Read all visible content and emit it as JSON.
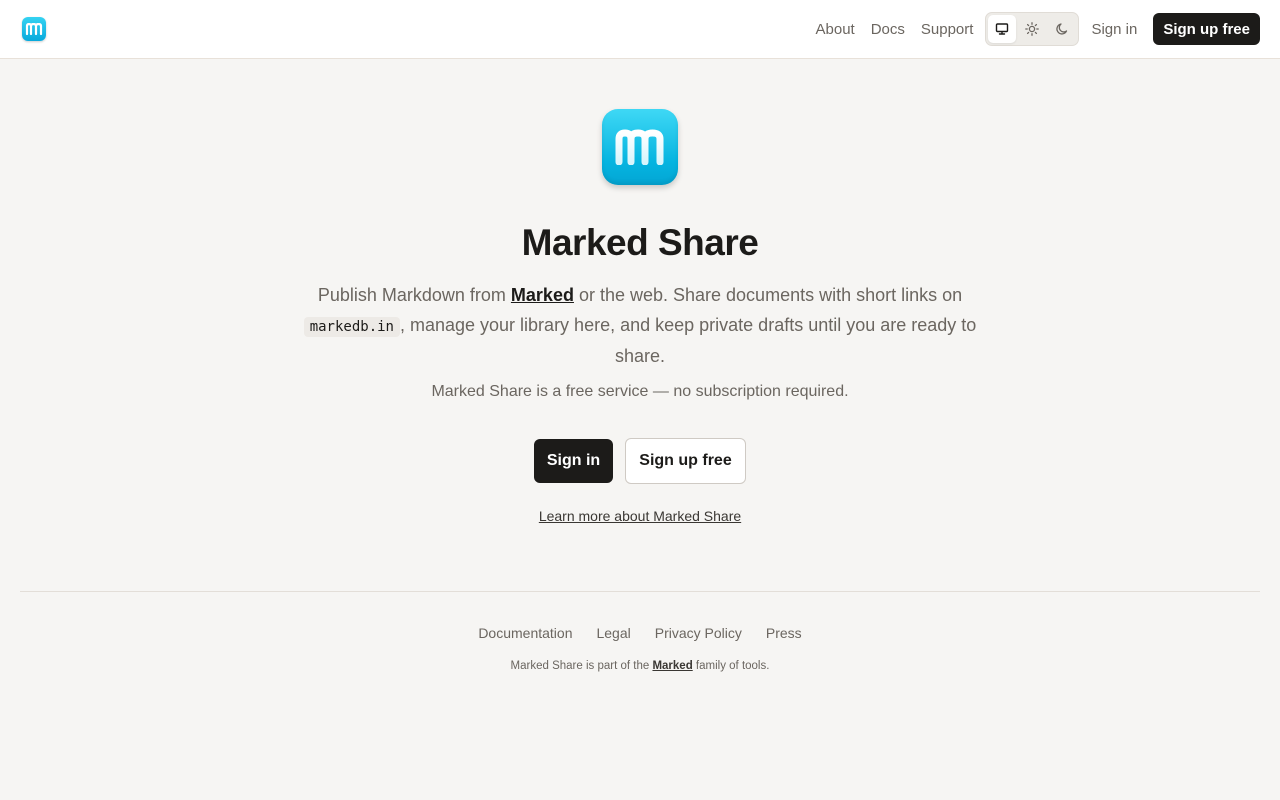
{
  "header": {
    "logo_icon": "marked-logo-icon",
    "nav": {
      "about": "About",
      "docs": "Docs",
      "support": "Support"
    },
    "theme_toggle": {
      "options": [
        {
          "icon": "monitor-icon",
          "active": true
        },
        {
          "icon": "sun-icon",
          "active": false
        },
        {
          "icon": "moon-icon",
          "active": false
        }
      ]
    },
    "sign_in": "Sign in",
    "sign_up": "Sign up free"
  },
  "hero": {
    "logo_icon": "marked-logo-icon",
    "title": "Marked Share",
    "desc": {
      "part1": "Publish Markdown from ",
      "link": "Marked",
      "part2": " or the web. Share documents with short links on ",
      "code": "markedb.in",
      "part3": ", manage your library here, and keep private drafts until you are ready to share."
    },
    "free_note": "Marked Share is a free service — no subscription required.",
    "sign_in_button": "Sign in",
    "sign_up_button": "Sign up free",
    "learn_more": "Learn more about Marked Share"
  },
  "footer": {
    "links": [
      "Documentation",
      "Legal",
      "Privacy Policy",
      "Press"
    ],
    "note_before": "Marked Share is part of the ",
    "note_link": "Marked",
    "note_after": " family of tools."
  },
  "colors": {
    "background": "#f6f5f3",
    "primary": "#1c1b19",
    "muted_text": "#6b6660",
    "logo_cyan": "#08b4e0"
  }
}
